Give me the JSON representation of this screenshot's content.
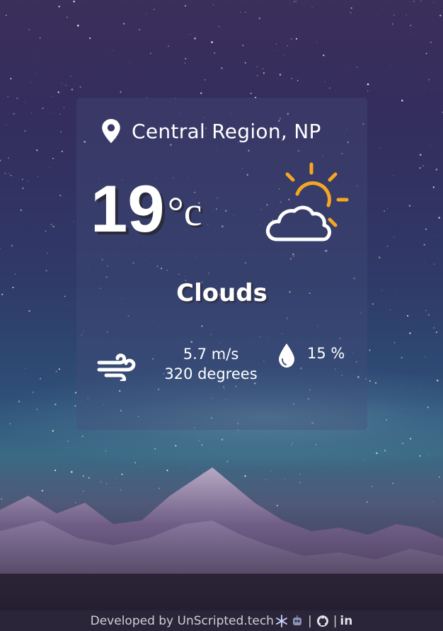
{
  "location": {
    "icon": "map-pin-icon",
    "name": "Central Region, NP"
  },
  "temperature": {
    "value": "19",
    "unit": "°c"
  },
  "weather_icon": "partly-cloudy-sun-icon",
  "condition": "Clouds",
  "wind": {
    "icon": "wind-icon",
    "speed": "5.7 m/s",
    "direction": "320 degrees"
  },
  "humidity": {
    "icon": "water-drop-icon",
    "value": "15 %"
  },
  "footer": {
    "text": "Developed by UnScripted.tech",
    "icons": [
      "snowflake-icon",
      "robot-icon",
      "github-icon",
      "linkedin-icon"
    ],
    "separator": "|",
    "linkedin_label": "in"
  },
  "colors": {
    "sun": "#f5a623",
    "text": "#ffffff"
  }
}
